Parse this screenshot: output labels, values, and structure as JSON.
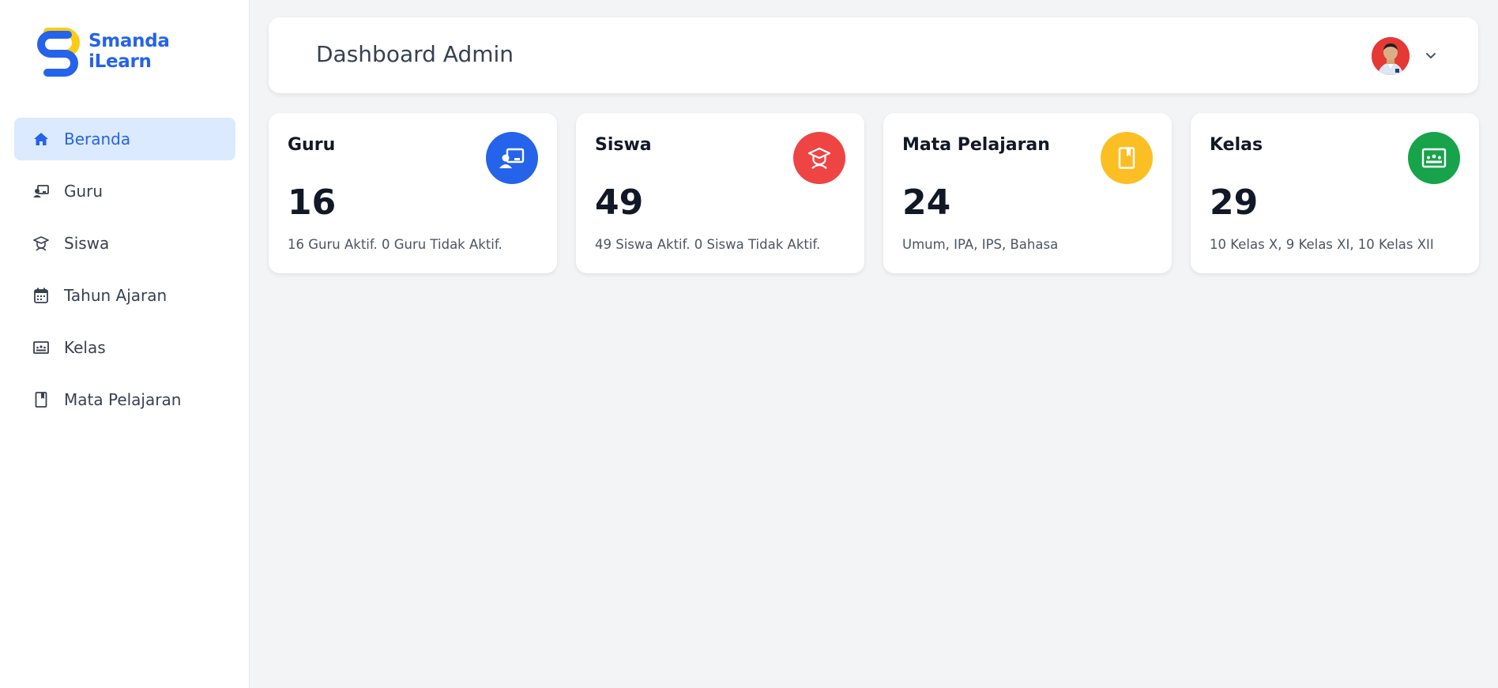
{
  "brand": {
    "line1": "Smanda",
    "line2": "iLearn",
    "color": "#2563eb",
    "accent": "#facc15"
  },
  "sidebar": {
    "items": [
      {
        "label": "Beranda",
        "icon": "home-icon",
        "active": true
      },
      {
        "label": "Guru",
        "icon": "teacher-icon"
      },
      {
        "label": "Siswa",
        "icon": "student-icon"
      },
      {
        "label": "Tahun Ajaran",
        "icon": "calendar-icon"
      },
      {
        "label": "Kelas",
        "icon": "classroom-icon"
      },
      {
        "label": "Mata Pelajaran",
        "icon": "book-icon"
      }
    ]
  },
  "header": {
    "title": "Dashboard Admin",
    "avatar_icon": "user-avatar",
    "menu_icon": "chevron-down-icon"
  },
  "cards": [
    {
      "title": "Guru",
      "value": "16",
      "description": "16 Guru Aktif. 0 Guru Tidak Aktif.",
      "icon": "teacher-icon",
      "color": "#2563eb"
    },
    {
      "title": "Siswa",
      "value": "49",
      "description": "49 Siswa Aktif. 0 Siswa Tidak Aktif.",
      "icon": "student-icon",
      "color": "#ef4444"
    },
    {
      "title": "Mata Pelajaran",
      "value": "24",
      "description": "Umum, IPA, IPS, Bahasa",
      "icon": "book-icon",
      "color": "#fbbf24"
    },
    {
      "title": "Kelas",
      "value": "29",
      "description": "10 Kelas X, 9 Kelas XI, 10 Kelas XII",
      "icon": "classroom-icon",
      "color": "#16a34a"
    }
  ]
}
